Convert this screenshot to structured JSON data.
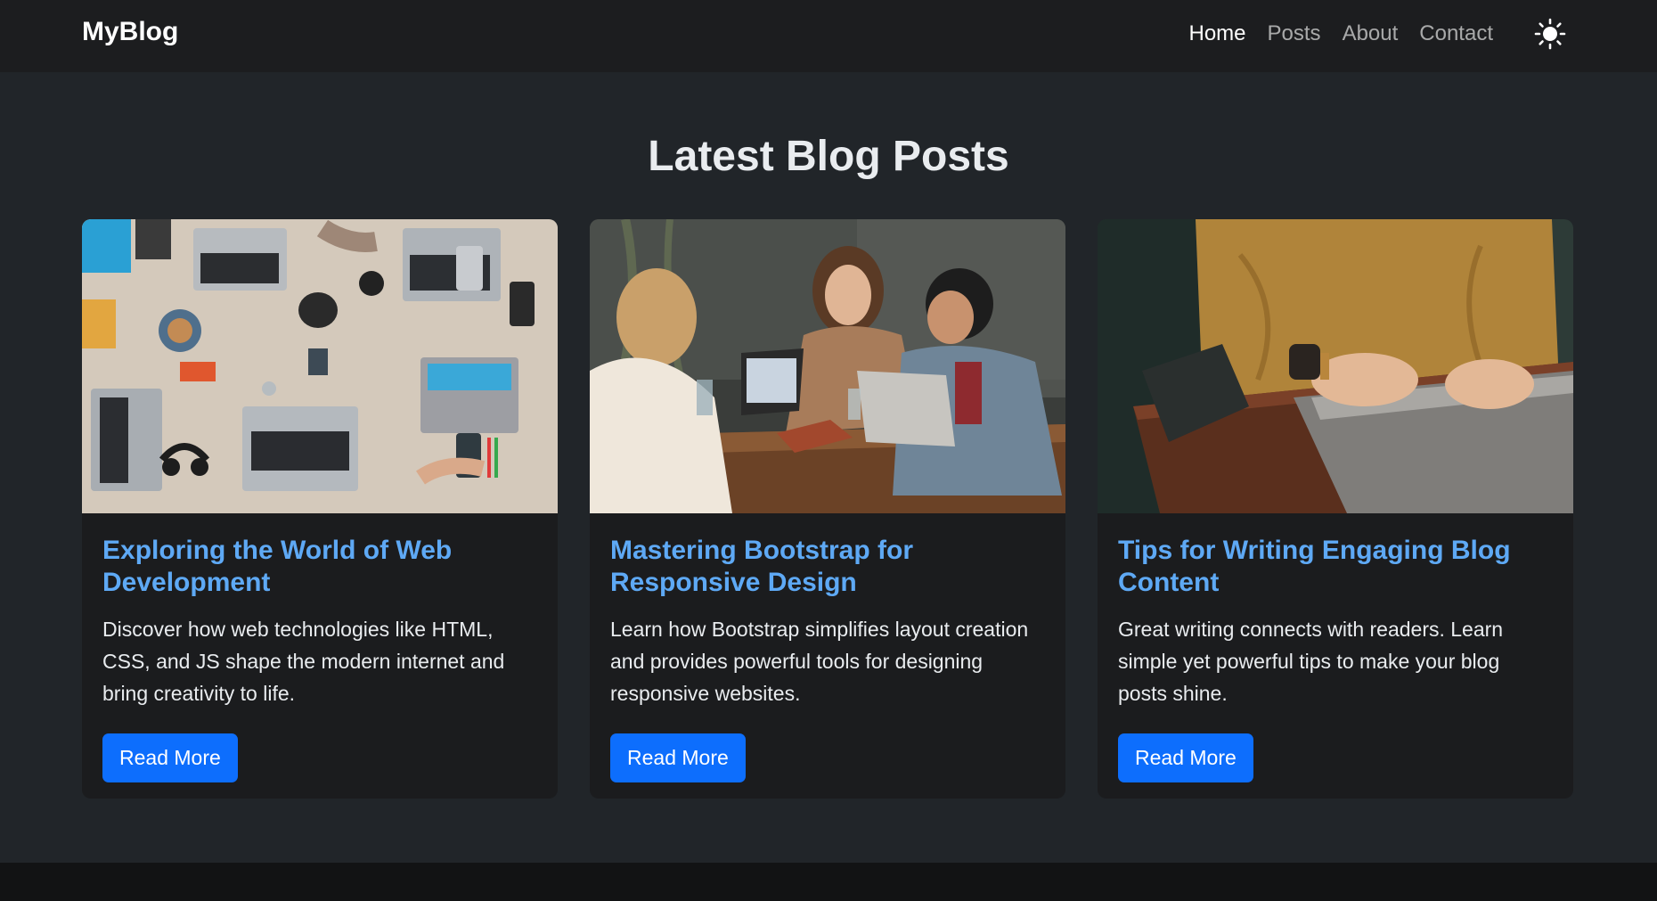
{
  "navbar": {
    "brand": "MyBlog",
    "links": [
      {
        "label": "Home",
        "active": true
      },
      {
        "label": "Posts",
        "active": false
      },
      {
        "label": "About",
        "active": false
      },
      {
        "label": "Contact",
        "active": false
      }
    ],
    "theme_icon": "sun-icon"
  },
  "main": {
    "heading": "Latest Blog Posts",
    "posts": [
      {
        "image": "overhead-desk-laptops-photo",
        "title": "Exploring the World of Web Development",
        "text": "Discover how web technologies like HTML, CSS, and JS shape the modern internet and bring creativity to life.",
        "button": "Read More"
      },
      {
        "image": "three-people-laughing-laptop-photo",
        "title": "Mastering Bootstrap for Responsive Design",
        "text": "Learn how Bootstrap simplifies layout creation and provides powerful tools for designing responsive websites.",
        "button": "Read More"
      },
      {
        "image": "hands-typing-laptop-sweater-photo",
        "title": "Tips for Writing Engaging Blog Content",
        "text": "Great writing connects with readers. Learn simple yet powerful tips to make your blog posts shine.",
        "button": "Read More"
      }
    ]
  },
  "colors": {
    "background": "#212529",
    "navbar": "#1c1d1f",
    "card": "#1b1c1e",
    "title_link": "#5ea9f5",
    "primary_button": "#0d6efd"
  }
}
